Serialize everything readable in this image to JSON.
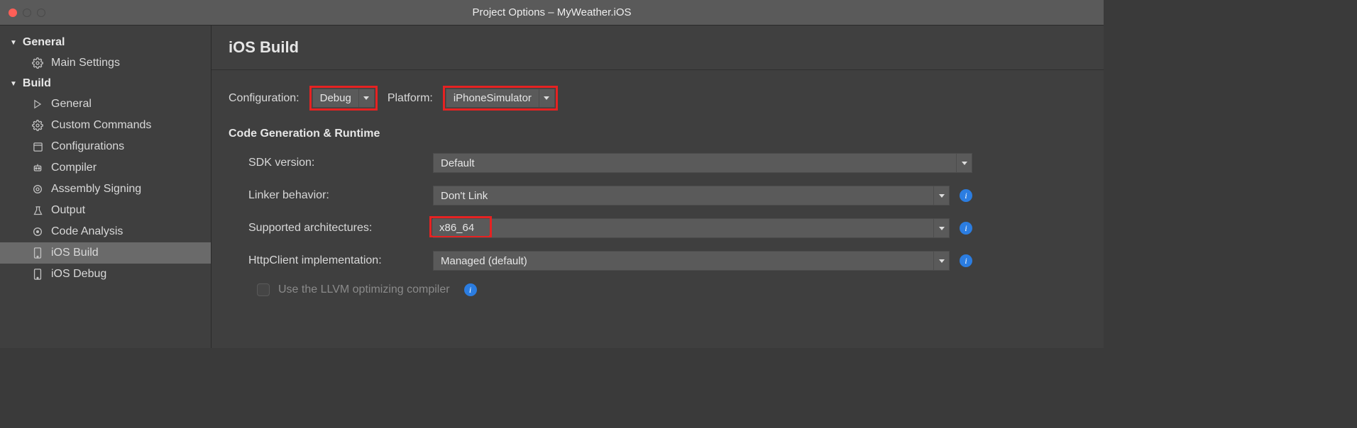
{
  "window": {
    "title": "Project Options – MyWeather.iOS"
  },
  "sidebar": {
    "sections": [
      {
        "label": "General",
        "items": [
          {
            "label": "Main Settings"
          }
        ]
      },
      {
        "label": "Build",
        "items": [
          {
            "label": "General"
          },
          {
            "label": "Custom Commands"
          },
          {
            "label": "Configurations"
          },
          {
            "label": "Compiler"
          },
          {
            "label": "Assembly Signing"
          },
          {
            "label": "Output"
          },
          {
            "label": "Code Analysis"
          },
          {
            "label": "iOS Build"
          },
          {
            "label": "iOS Debug"
          }
        ]
      }
    ]
  },
  "main": {
    "title": "iOS Build",
    "configuration_label": "Configuration:",
    "configuration_value": "Debug",
    "platform_label": "Platform:",
    "platform_value": "iPhoneSimulator",
    "section_title": "Code Generation & Runtime",
    "rows": {
      "sdk_label": "SDK version:",
      "sdk_value": "Default",
      "linker_label": "Linker behavior:",
      "linker_value": "Don't Link",
      "arch_label": "Supported architectures:",
      "arch_value": "x86_64",
      "http_label": "HttpClient implementation:",
      "http_value": "Managed (default)",
      "llvm_label": "Use the LLVM optimizing compiler"
    }
  }
}
